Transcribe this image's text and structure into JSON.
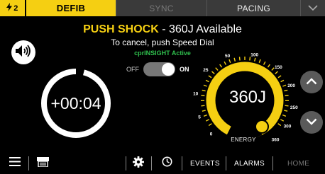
{
  "tabs": {
    "alert_number": "2",
    "defib": "DEFIB",
    "sync": "SYNC",
    "pacing": "PACING"
  },
  "header": {
    "shock_label": "PUSH SHOCK",
    "available": " - 360J Available",
    "cancel_hint": "To cancel, push Speed Dial",
    "cpr_status": "cprINSIGHT Active"
  },
  "cpr_toggle": {
    "off_label": "OFF",
    "on_label": "ON",
    "state": "on"
  },
  "timer": {
    "value": "+00:04"
  },
  "energy_dial": {
    "value": "360J",
    "label": "ENERGY",
    "scale_min": 0,
    "scale_max": 360,
    "tick_labels": [
      "0",
      "5",
      "10",
      "25",
      "50",
      "100",
      "150",
      "200",
      "250",
      "300",
      "360"
    ],
    "selected": 360
  },
  "toolbar": {
    "events": "EVENTS",
    "alarms": "ALARMS",
    "home": "HOME"
  },
  "colors": {
    "accent": "#f5cf12",
    "cpr_green": "#2fbf4d",
    "tab_bg": "#3a3a3a",
    "disabled_text": "#777777"
  },
  "icons": {
    "top_right": "chevron-down-icon",
    "speaker": "speaker-icon",
    "scroll_up": "chevron-up-icon",
    "scroll_down": "chevron-down-icon",
    "menu": "hamburger-menu-icon",
    "printer": "printer-icon",
    "settings": "gear-icon",
    "timer_face": "clock-icon"
  }
}
